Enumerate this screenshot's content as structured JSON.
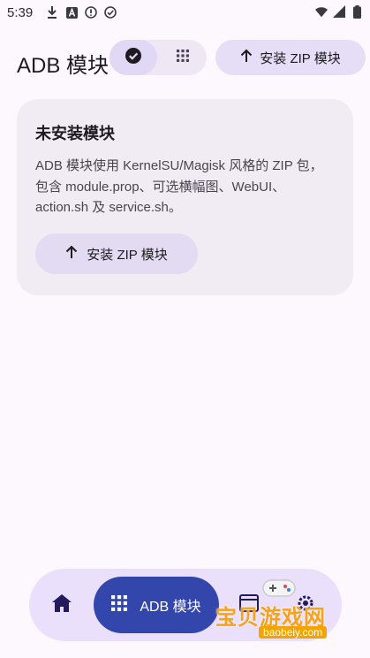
{
  "status_bar": {
    "time": "5:39",
    "left_icons": [
      "download-icon",
      "font-a-icon",
      "alert-circle-icon",
      "check-circle-icon"
    ],
    "right_icons": [
      "wifi-icon",
      "signal-icon",
      "battery-icon"
    ]
  },
  "top_bar": {
    "title": "ADB 模块",
    "view_toggle": {
      "selected_icon": "check-circle-icon",
      "other_icon": "grid-icon"
    },
    "install_button_label": "安装 ZIP 模块"
  },
  "card": {
    "title": "未安装模块",
    "description": "ADB 模块使用 KernelSU/Magisk 风格的 ZIP 包，包含 module.prop、可选横幅图、WebUI、action.sh 及 service.sh。",
    "button_label": "安装 ZIP 模块"
  },
  "nav": {
    "items": [
      {
        "icon": "home-icon"
      },
      {
        "icon": "grid-icon",
        "label": "ADB 模块"
      },
      {
        "icon": "window-icon"
      },
      {
        "icon": "settings-icon"
      }
    ]
  },
  "watermark": {
    "text": "宝贝游戏网",
    "url": "baobeiy.com"
  },
  "colors": {
    "background": "#fdf7fe",
    "card": "#f1ebf3",
    "tonal_button": "#e3dbf2",
    "nav_active": "#3346ab",
    "nav_bar": "#eae0fb"
  }
}
